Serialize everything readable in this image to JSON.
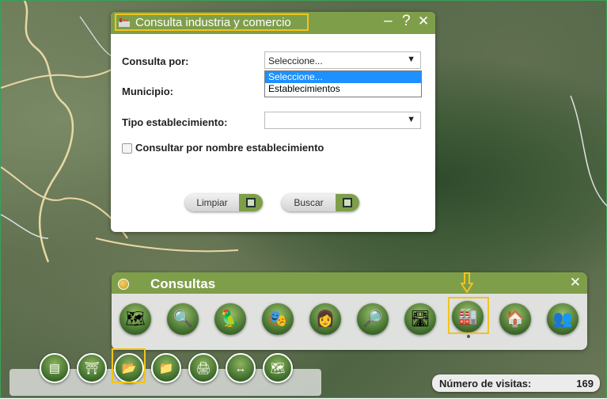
{
  "dialog": {
    "title": "Consulta industria y comercio",
    "controls": {
      "minimize": "–",
      "help": "?",
      "close": "✕"
    },
    "fields": {
      "consulta_por_label": "Consulta por:",
      "consulta_por_value": "Seleccione...",
      "municipio_label": "Municipio:",
      "tipo_label": "Tipo establecimiento:",
      "tipo_value": "",
      "checkbox_label": "Consultar por nombre establecimiento"
    },
    "dropdown_options": [
      "Seleccione...",
      "Establecimientos"
    ],
    "buttons": {
      "limpiar": "Limpiar",
      "buscar": "Buscar"
    }
  },
  "panel": {
    "title": "Consultas",
    "close": "✕",
    "icons": [
      "map-icon",
      "search-globe-icon",
      "bird-icon",
      "theater-masks-icon",
      "doctor-icon",
      "magnifier-icon",
      "road-icon",
      "industry-icon",
      "house-icon",
      "people-icon"
    ]
  },
  "toolbar": {
    "tools": [
      "legend-icon",
      "layers-icon",
      "folder-open-icon",
      "folder-icon",
      "printer-icon",
      "measure-icon",
      "map-icon"
    ]
  },
  "visits": {
    "label": "Número de visitas:",
    "value": "169"
  },
  "colors": {
    "accent": "#7f9e4a",
    "highlight": "#f2c31b",
    "selected": "#1e90ff"
  }
}
